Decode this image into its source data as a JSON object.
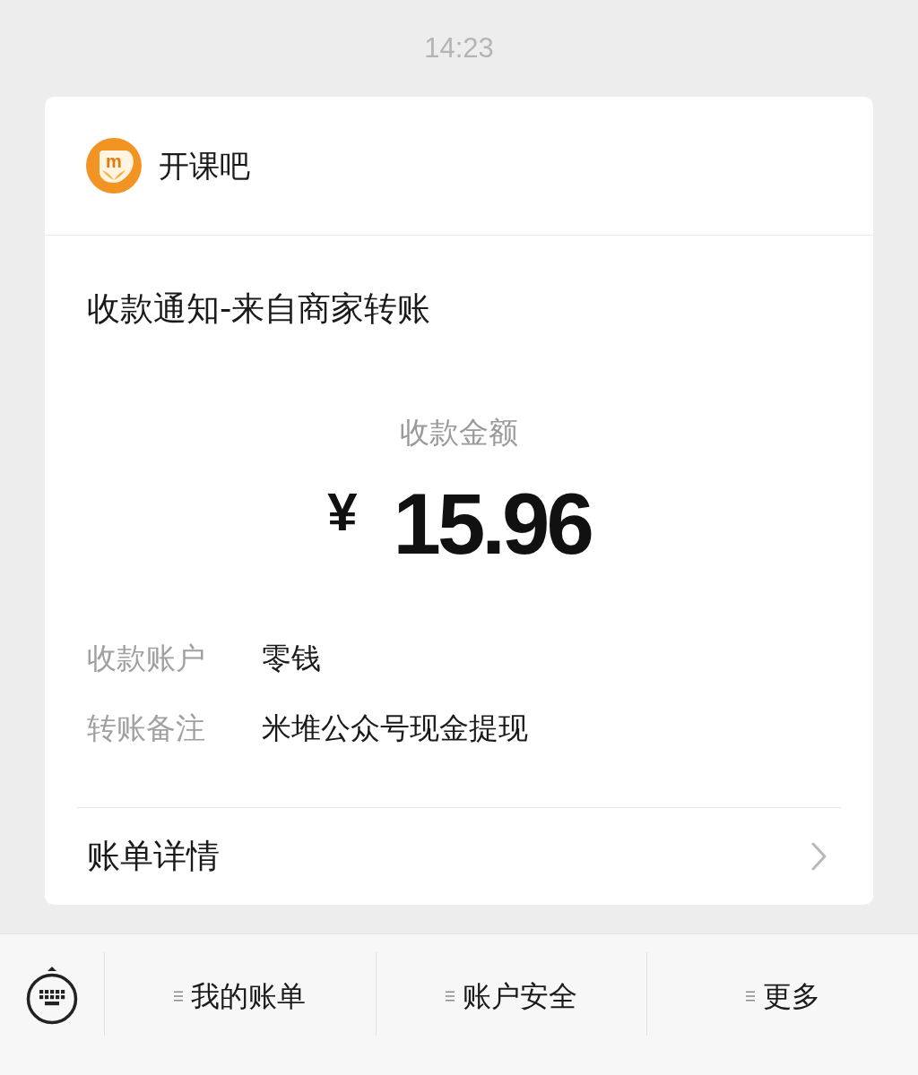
{
  "status_time": "14:23",
  "card": {
    "merchant": {
      "logo_mark": "m",
      "name": "开课吧"
    },
    "title": "收款通知-来自商家转账",
    "amount_label": "收款金额",
    "currency": "¥",
    "amount": "15.96",
    "details": [
      {
        "label": "收款账户",
        "value": "零钱"
      },
      {
        "label": "转账备注",
        "value": "米堆公众号现金提现"
      }
    ],
    "link": {
      "label": "账单详情"
    }
  },
  "bottom_menu": {
    "items": [
      {
        "label": "我的账单"
      },
      {
        "label": "账户安全"
      },
      {
        "label": "更多"
      }
    ]
  }
}
